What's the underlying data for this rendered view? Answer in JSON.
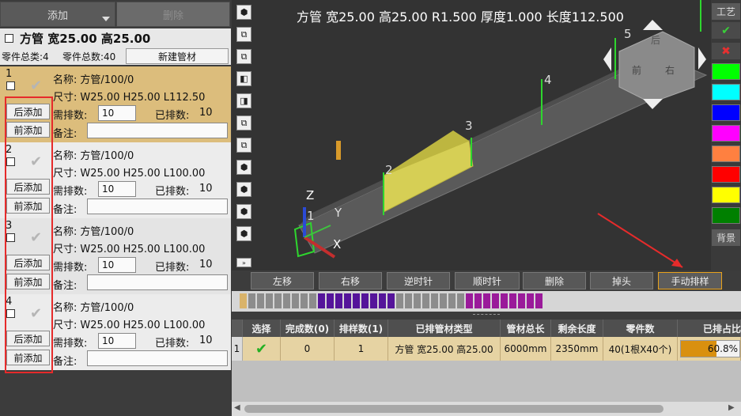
{
  "left_panel": {
    "add_label": "添加",
    "delete_label": "删除",
    "header_title": "方管 宽25.00 高25.00",
    "summary_types": "零件总类:4",
    "summary_count": "零件总数:40",
    "new_pipe_label": "新建管材",
    "labels": {
      "name": "名称:",
      "size": "尺寸:",
      "need": "需排数:",
      "done": "已排数:",
      "note": "备注:",
      "add_after": "后添加",
      "add_before": "前添加"
    },
    "parts": [
      {
        "index": "1",
        "name": "方管/100/0",
        "size": "W25.00 H25.00 L112.50",
        "need": "10",
        "done": "10"
      },
      {
        "index": "2",
        "name": "方管/100/0",
        "size": "W25.00 H25.00 L100.00",
        "need": "10",
        "done": "10"
      },
      {
        "index": "3",
        "name": "方管/100/0",
        "size": "W25.00 H25.00 L100.00",
        "need": "10",
        "done": "10"
      },
      {
        "index": "4",
        "name": "方管/100/0",
        "size": "W25.00 H25.00 L100.00",
        "need": "10",
        "done": "10"
      }
    ]
  },
  "viewport": {
    "title": "方管 宽25.00 高25.00 R1.500 厚度1.000 长度112.500",
    "axis_x": "X",
    "axis_y": "Y",
    "axis_z": "Z",
    "markers": [
      "1",
      "2",
      "3",
      "4",
      "5"
    ],
    "cube_faces": {
      "top": "后",
      "front": "前",
      "right": "右"
    }
  },
  "right_palette": {
    "top_label": "工艺",
    "bottom_label": "背景",
    "colors": [
      "#00ff00",
      "#00ffff",
      "#0000ff",
      "#ff00ff",
      "#ff8040",
      "#ff0000",
      "#ffff00",
      "#008000"
    ]
  },
  "toolbar": {
    "buttons": [
      "左移",
      "右移",
      "逆时针",
      "顺时针",
      "删除",
      "掉头",
      "手动排样"
    ]
  },
  "table": {
    "headers": [
      "选择",
      "完成数(0)",
      "排样数(1)",
      "已排管材类型",
      "管材总长",
      "剩余长度",
      "零件数",
      "已排占比"
    ],
    "rows": [
      {
        "row": "1",
        "completed": "0",
        "layout": "1",
        "type": "方管 宽25.00 高25.00",
        "total": "6000mm",
        "remaining": "2350mm",
        "parts": "40(1根X40个)",
        "ratio": "60.8%",
        "ratio_value": 0.608
      }
    ]
  }
}
